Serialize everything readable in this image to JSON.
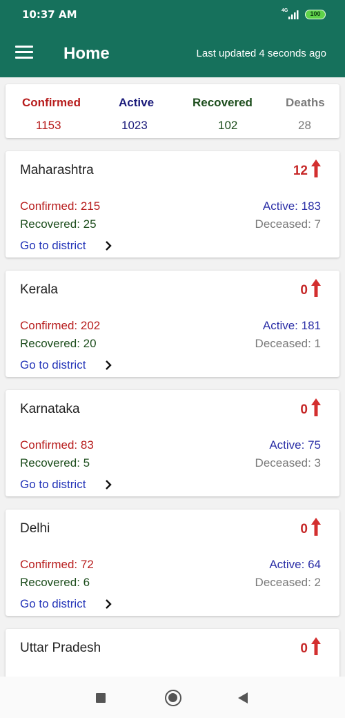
{
  "status_bar": {
    "time": "10:37 AM",
    "network": "4G",
    "battery": "100"
  },
  "app_bar": {
    "title": "Home",
    "last_updated": "Last updated 4 seconds ago"
  },
  "summary": {
    "confirmed_label": "Confirmed",
    "confirmed_value": "1153",
    "active_label": "Active",
    "active_value": "1023",
    "recovered_label": "Recovered",
    "recovered_value": "102",
    "deaths_label": "Deaths",
    "deaths_value": "28"
  },
  "states": [
    {
      "name": "Maharashtra",
      "delta": "12",
      "confirmed": "Confirmed: 215",
      "active": "Active: 183",
      "recovered": "Recovered: 25",
      "deceased": "Deceased: 7",
      "link": "Go to district"
    },
    {
      "name": "Kerala",
      "delta": "0",
      "confirmed": "Confirmed: 202",
      "active": "Active: 181",
      "recovered": "Recovered: 20",
      "deceased": "Deceased: 1",
      "link": "Go to district"
    },
    {
      "name": "Karnataka",
      "delta": "0",
      "confirmed": "Confirmed: 83",
      "active": "Active: 75",
      "recovered": "Recovered: 5",
      "deceased": "Deceased: 3",
      "link": "Go to district"
    },
    {
      "name": "Delhi",
      "delta": "0",
      "confirmed": "Confirmed: 72",
      "active": "Active: 64",
      "recovered": "Recovered: 6",
      "deceased": "Deceased: 2",
      "link": "Go to district"
    },
    {
      "name": "Uttar Pradesh",
      "delta": "0"
    }
  ],
  "colors": {
    "primary": "#16715c",
    "confirmed": "#b71c1c",
    "active": "#2a2ea6",
    "recovered": "#1c4d1c",
    "deceased": "#7a7a7a",
    "link": "#2233b8",
    "increase_arrow": "#d32f2f"
  },
  "icons": {
    "menu": "menu-icon",
    "increase": "arrow-up-icon",
    "chevron": "chevron-right-icon",
    "nav_recents": "square-icon",
    "nav_home": "circle-icon",
    "nav_back": "triangle-back-icon"
  }
}
